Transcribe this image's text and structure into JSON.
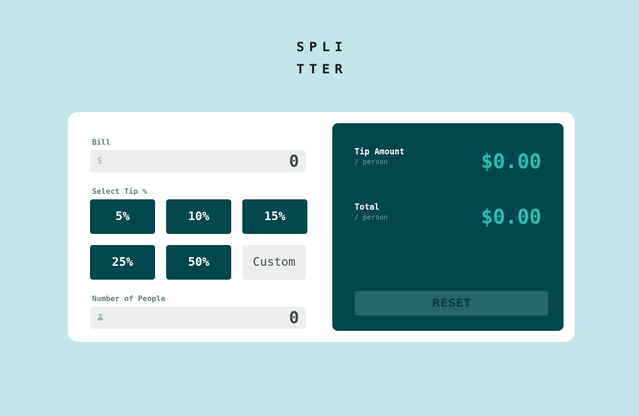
{
  "logo": {
    "line1": "SPLI",
    "line2": "TTER"
  },
  "bill": {
    "label": "Bill",
    "prefix": "$",
    "value": "0"
  },
  "tip": {
    "label": "Select Tip %",
    "options": [
      "5%",
      "10%",
      "15%",
      "25%",
      "50%"
    ],
    "custom_placeholder": "Custom"
  },
  "people": {
    "label": "Number of People",
    "icon": "person-icon",
    "value": "0"
  },
  "results": {
    "tip_amount": {
      "title": "Tip Amount",
      "sub": "/ person",
      "value": "$0.00"
    },
    "total": {
      "title": "Total",
      "sub": "/ person",
      "value": "$0.00"
    },
    "reset_label": "RESET"
  },
  "colors": {
    "background": "#c5e4e7",
    "dark_cyan": "#00474b",
    "strong_cyan": "#26c2ad",
    "input_bg": "#eeeeee"
  }
}
